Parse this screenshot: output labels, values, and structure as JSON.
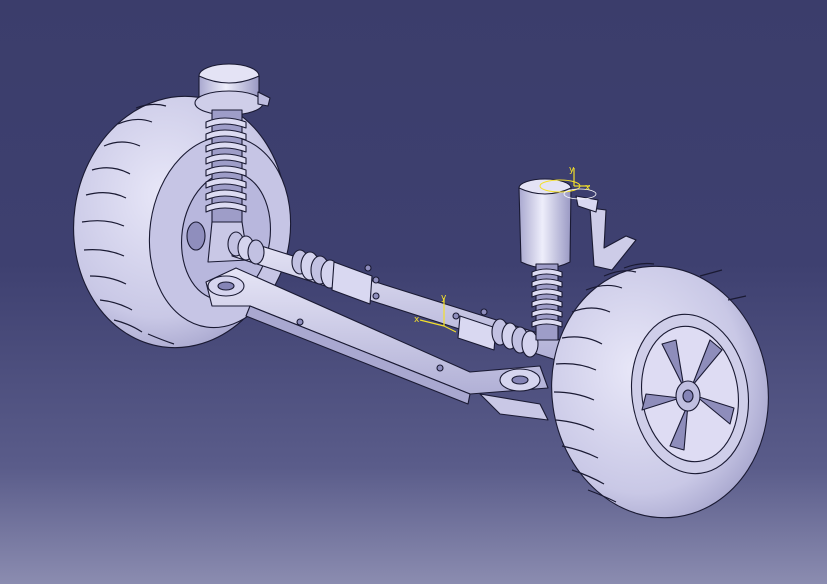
{
  "viewer": {
    "background_top": "#3b3d6b",
    "background_bottom": "#8b8cb0",
    "part_color": "#d7d6ef",
    "edge_color": "#1a1a33",
    "axis_color": "#f4e02a"
  },
  "model": {
    "components": [
      "left-wheel",
      "right-wheel",
      "left-coil-spring-strut",
      "right-coil-spring-strut",
      "steering-rack-housing",
      "tie-rod-bellows",
      "lower-control-arm-subframe",
      "mounting-brackets"
    ]
  },
  "axes": {
    "strut_top_y": "y",
    "strut_top_x": "x",
    "center_y": "y",
    "center_x": "x"
  }
}
